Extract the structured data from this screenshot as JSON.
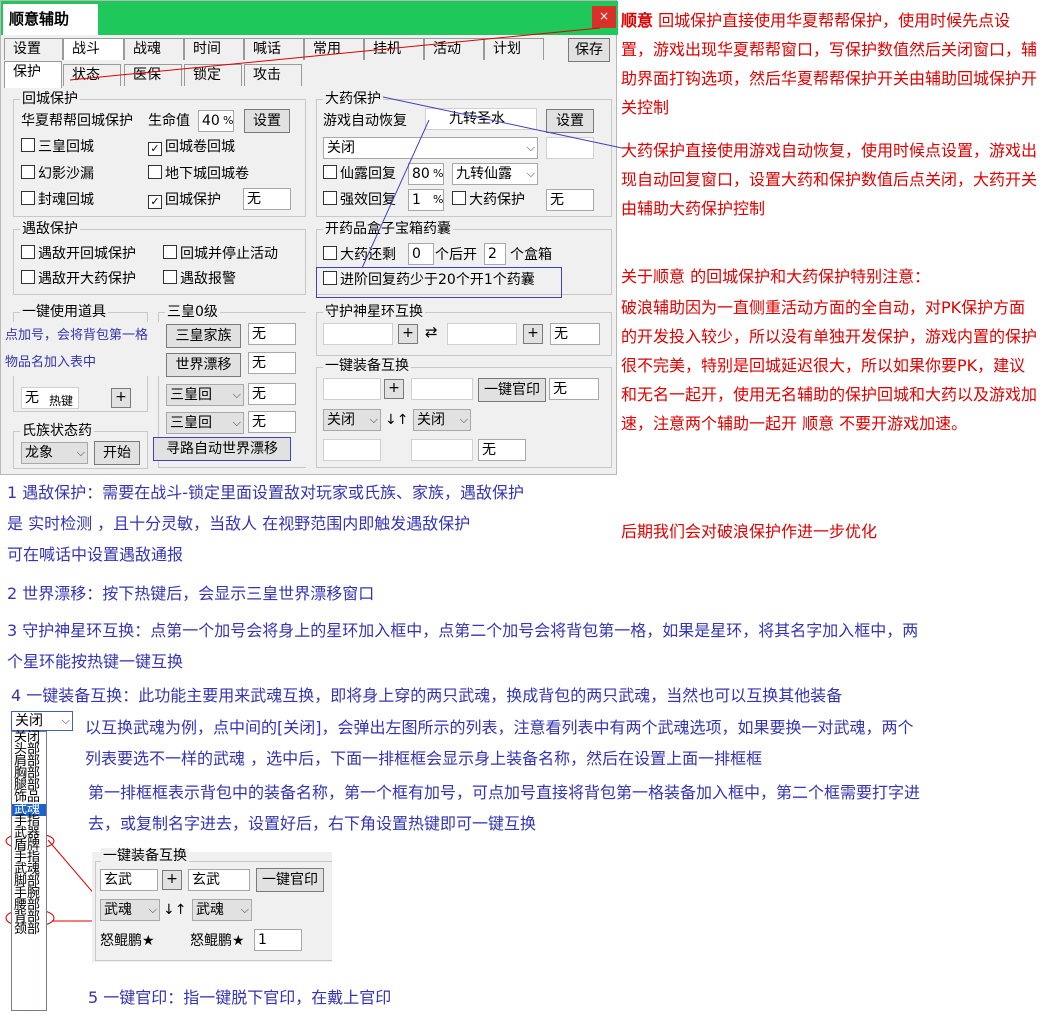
{
  "window": {
    "title": "顺意辅助",
    "close_glyph": "×",
    "main_tabs": [
      "设置",
      "战斗",
      "战魂",
      "时间",
      "喊话",
      "常用",
      "挂机",
      "活动",
      "计划"
    ],
    "save_label": "保存",
    "sub_tabs": [
      "保护",
      "状态",
      "医保",
      "锁定",
      "攻击"
    ]
  },
  "city": {
    "title": "回城保护",
    "hx_label": "华夏帮帮回城保护",
    "life_label": "生命值",
    "life_value": "40",
    "pct": "%",
    "set_label": "设置",
    "checks": [
      {
        "label": "三皇回城",
        "checked": false
      },
      {
        "label": "回城卷回城",
        "checked": true
      },
      {
        "label": "幻影沙漏",
        "checked": false
      },
      {
        "label": "地下城回城卷",
        "checked": false
      },
      {
        "label": "封魂回城",
        "checked": false
      },
      {
        "label": "回城保护",
        "checked": true
      }
    ],
    "guard_value": "无"
  },
  "potion": {
    "title": "大药保护",
    "auto_label": "游戏自动恢复",
    "item_label": "九转圣水",
    "set_label": "设置",
    "mode_value": "关闭",
    "xianlu_label": "仙露回复",
    "xianlu_value": "80",
    "pct": "%",
    "xianlu_item": "九转仙露",
    "qiangxiao_label": "强效回复",
    "qiangxiao_value": "1",
    "dayao_label": "大药保护",
    "dayao_value": "无"
  },
  "enemy": {
    "title": "遇敌保护",
    "checks": [
      "遇敌开回城保护",
      "回城并停止活动",
      "遇敌开大药保护",
      "遇敌报警"
    ]
  },
  "box": {
    "title": "开药品盒子宝箱药囊",
    "check1": "大药还剩",
    "v1": "0",
    "t1": "个后开",
    "v2": "2",
    "t2": "个盒箱",
    "check2": "进阶回复药少于20个开1个药囊"
  },
  "onekey": {
    "title": "一键使用道具",
    "value": "无",
    "hotkey_label": "热键",
    "plus": "+"
  },
  "sanhuang": {
    "title": "三皇0级",
    "btn1": "三皇家族",
    "v1": "无",
    "btn2": "世界漂移",
    "v2": "无",
    "sel3": "三皇回",
    "v3": "无",
    "sel4": "三皇回",
    "v4": "无",
    "path_btn": "寻路自动世界漂移"
  },
  "clan": {
    "title": "氏族状态药",
    "sel": "龙象",
    "start": "开始"
  },
  "star": {
    "title": "守护神星环互换",
    "plus": "+",
    "swap": "⇄",
    "value": "无"
  },
  "equip": {
    "title": "一键装备互换",
    "plus": "+",
    "guanyin": "一键官印",
    "value": "无",
    "sel_left": "关闭",
    "sel_right": "关闭",
    "arrows": "↓↑",
    "value2": "无"
  },
  "overlay_note": "点加号，会将背包第一格物品名加入表中",
  "red_notes": [
    {
      "strong": "顺意",
      "text": " 回城保护直接使用华夏帮帮保护，使用时候先点设置，游戏出现华夏帮帮窗口，写保护数值然后关闭窗口，辅助界面打钩选项，然后华夏帮帮保护开关由辅助回城保护开关控制"
    },
    {
      "strong": "",
      "text": "大药保护直接使用游戏自动恢复，使用时候点设置，游戏出现自动回复窗口，设置大药和保护数值后点关闭，大药开关由辅助大药保护控制"
    },
    {
      "strong": "",
      "text": "关于顺意 的回城保护和大药保护特别注意："
    },
    {
      "strong": "",
      "text": "破浪辅助因为一直侧重活动方面的全自动，对PK保护方面的开发投入较少，所以没有单独开发保护，游戏内置的保护很不完美，特别是回城延迟很大，所以如果你要PK，建议和无名一起开，使用无名辅助的保护回城和大药以及游戏加速，注意两个辅助一起开 顺意 不要开游戏加速。"
    },
    {
      "strong": "",
      "text": "后期我们会对破浪保护作进一步优化"
    }
  ],
  "blue_notes": {
    "n1a": "1 遇敌保护：需要在战斗-锁定里面设置敌对玩家或氏族、家族，遇敌保护",
    "n1b": "是  实时检测 ，且十分灵敏，当敌人 在视野范围内即触发遇敌保护",
    "n1c": " 可在喊话中设置遇敌通报",
    "n2": "2 世界漂移：按下热键后，会显示三皇世界漂移窗口",
    "n3a": "3 守护神星环互换：点第一个加号会将身上的星环加入框中，点第二个加号会将背包第一格，如果是星环，将其名字加入框中，两",
    "n3b": "个星环能按热键一键互换",
    "n4": "4 一键装备互换：此功能主要用来武魂互换，即将身上穿的两只武魂，换成背包的两只武魂，当然也可以互换其他装备",
    "n4a": "以互换武魂为例，点中间的[关闭]，会弹出左图所示的列表，注意看列表中有两个武魂选项，如果要换一对武魂，两个",
    "n4b": "列表要选不一样的武魂 ，选中后，下面一排框框会显示身上装备名称，然后在设置上面一排框框",
    "n4c": "第一排框框表示背包中的装备名称，第一个框有加号，可点加号直接将背包第一格装备加入框中，第二个框需要打字进",
    "n4d": "去，或复制名字进去，设置好后，右下角设置热键即可一键互换",
    "n5": "5 一键官印：指一键脱下官印，在戴上官印"
  },
  "dropdown": {
    "value": "关闭",
    "items": [
      "关闭",
      "头部",
      "肩部",
      "胸部",
      "腿部",
      "饰品",
      "武魂",
      "手指",
      "武器",
      "盾牌",
      "手指",
      "武魂",
      "脚部",
      "手腕",
      "腰部",
      "背部",
      "颈部"
    ],
    "selected_index": 6
  },
  "example": {
    "title": "一键装备互换",
    "in1": "玄武",
    "plus": "+",
    "in2": "玄武",
    "guanyin": "一键官印",
    "sel1": "武魂",
    "arrows": "↓↑",
    "sel2": "武魂",
    "name1": "怒鲲鹏★",
    "name2": "怒鲲鹏★",
    "v": "1"
  },
  "colors": {
    "title_green": "#1fc85a",
    "close_red": "#d9302a",
    "note_red": "#e00000",
    "note_blue": "#3434b4",
    "list_select": "#1e64c8"
  }
}
